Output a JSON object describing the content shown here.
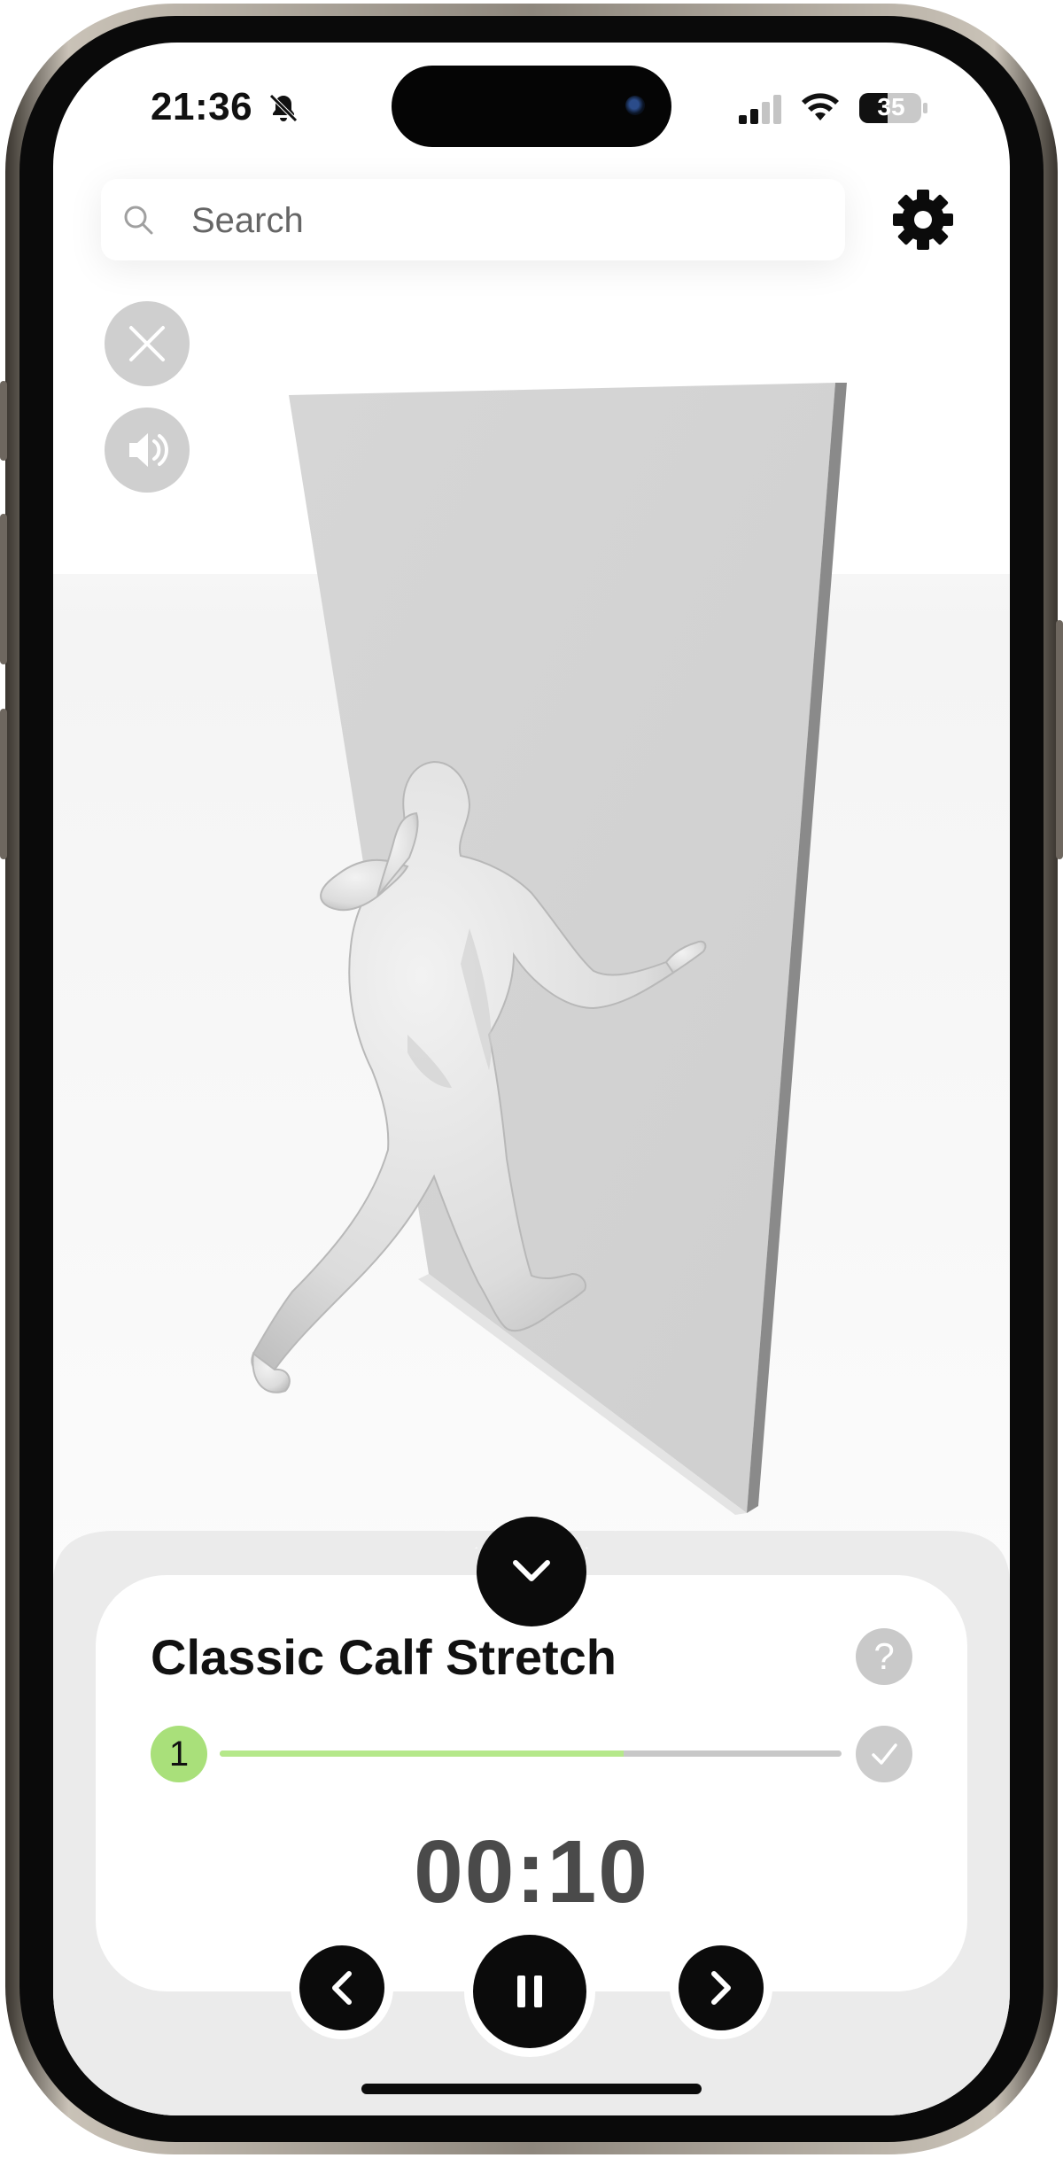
{
  "status_bar": {
    "time": "21:36",
    "battery_level": "35",
    "icons": [
      "bell-muted-icon",
      "signal-icon",
      "wifi-icon",
      "battery-icon"
    ]
  },
  "search": {
    "placeholder": "Search"
  },
  "exercise": {
    "title": "Classic Calf Stretch",
    "current_step": "1",
    "progress_fraction": 0.65,
    "timer": "00:10"
  },
  "controls": {
    "icons": [
      "close-icon",
      "sound-icon",
      "collapse-chevron-icon",
      "help-icon",
      "check-icon",
      "previous-icon",
      "pause-icon",
      "next-icon"
    ],
    "help_label": "?"
  },
  "colors": {
    "accent_green": "#a9e07a",
    "progress_fill": "#b5e88a",
    "control_dark": "#0b0b0b",
    "timer_text": "#4a4a4a"
  }
}
